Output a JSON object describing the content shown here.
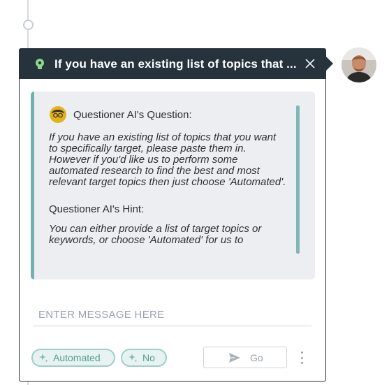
{
  "header": {
    "title": "If you have an existing list of topics that ...",
    "icon": "lightbulb-icon",
    "close_icon": "close-icon"
  },
  "question": {
    "label": "Questioner AI's Question:",
    "lines": [
      "If you have an existing list of topics that you want to specifically target, please paste them in.",
      "However if you'd like us to perform some automated research to find the best and most relevant target topics then just choose 'Automated'."
    ],
    "hint_label": "Questioner AI's Hint:",
    "hint_text": "You can either provide a list of target topics or keywords, or choose 'Automated' for us to"
  },
  "input": {
    "placeholder": "ENTER MESSAGE HERE",
    "value": ""
  },
  "actions": {
    "automated_label": "Automated",
    "no_label": "No",
    "go_label": "Go"
  },
  "colors": {
    "header_bg": "#26323c",
    "accent_teal": "#74b0ad",
    "question_bg": "#edeef1",
    "chip_bg": "#e6f3f1",
    "bulb": "#8fd68a"
  }
}
